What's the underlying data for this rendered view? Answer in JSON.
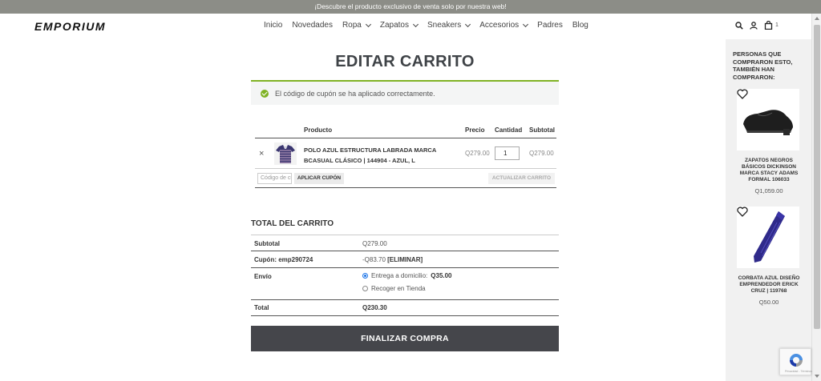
{
  "announcement": "¡Descubre el producto exclusivo de venta solo por nuestra web!",
  "brand": "EMPORIUM",
  "nav": {
    "items": [
      {
        "label": "Inicio",
        "dropdown": false
      },
      {
        "label": "Novedades",
        "dropdown": false
      },
      {
        "label": "Ropa",
        "dropdown": true
      },
      {
        "label": "Zapatos",
        "dropdown": true
      },
      {
        "label": "Sneakers",
        "dropdown": true
      },
      {
        "label": "Accesorios",
        "dropdown": true
      },
      {
        "label": "Padres",
        "dropdown": false
      },
      {
        "label": "Blog",
        "dropdown": false
      }
    ]
  },
  "header_icons": {
    "search": "search-icon",
    "account": "user-icon",
    "cart": "bag-icon",
    "cart_count": "1"
  },
  "page": {
    "title": "EDITAR CARRITO",
    "notice": "El código de cupón se ha aplicado correctamente."
  },
  "cart": {
    "headers": {
      "product": "Producto",
      "price": "Precio",
      "quantity": "Cantidad",
      "subtotal": "Subtotal"
    },
    "item": {
      "remove_symbol": "×",
      "name": "POLO AZUL ESTRUCTURA LABRADA MARCA BCASUAL CLÁSICO | 144904 - AZUL, L",
      "price": "Q279.00",
      "quantity": "1",
      "subtotal": "Q279.00"
    },
    "coupon_placeholder": "Código de cupón",
    "apply_coupon_label": "APLICAR CUPÓN",
    "update_cart_label": "ACTUALIZAR CARRITO"
  },
  "totals": {
    "title": "TOTAL DEL CARRITO",
    "subtotal_label": "Subtotal",
    "subtotal_value": "Q279.00",
    "coupon_label": "Cupón: emp290724",
    "coupon_value": "-Q83.70",
    "coupon_remove": "[ELIMINAR]",
    "shipping_label": "Envío",
    "shipping_option_1_text": "Entrega a domicilio:",
    "shipping_option_1_price": "Q35.00",
    "shipping_option_1_selected": true,
    "shipping_option_2": "Recoger en Tienda",
    "total_label": "Total",
    "total_value": "Q230.30"
  },
  "checkout_label": "FINALIZAR COMPRA",
  "sidebar": {
    "title": "PERSONAS QUE COMPRARON ESTO, TAMBIÉN HAN COMPRARON:",
    "products": [
      {
        "name": "ZAPATOS NEGROS BÁSICOS DICKINSON MARCA STACY ADAMS FORMAL 106033",
        "price": "Q1,059.00"
      },
      {
        "name": "CORBATA AZUL DISEÑO EMPRENDEDOR ERICK CRUZ | 119768",
        "price": "Q50.00"
      }
    ]
  },
  "recaptcha_text": "Privacidad - Términos",
  "colors": {
    "announcement_bg": "#8c8d87",
    "accent_green": "#7fb224",
    "checkout_bg": "#45464b",
    "sidebar_bg": "#f1f1f1"
  }
}
